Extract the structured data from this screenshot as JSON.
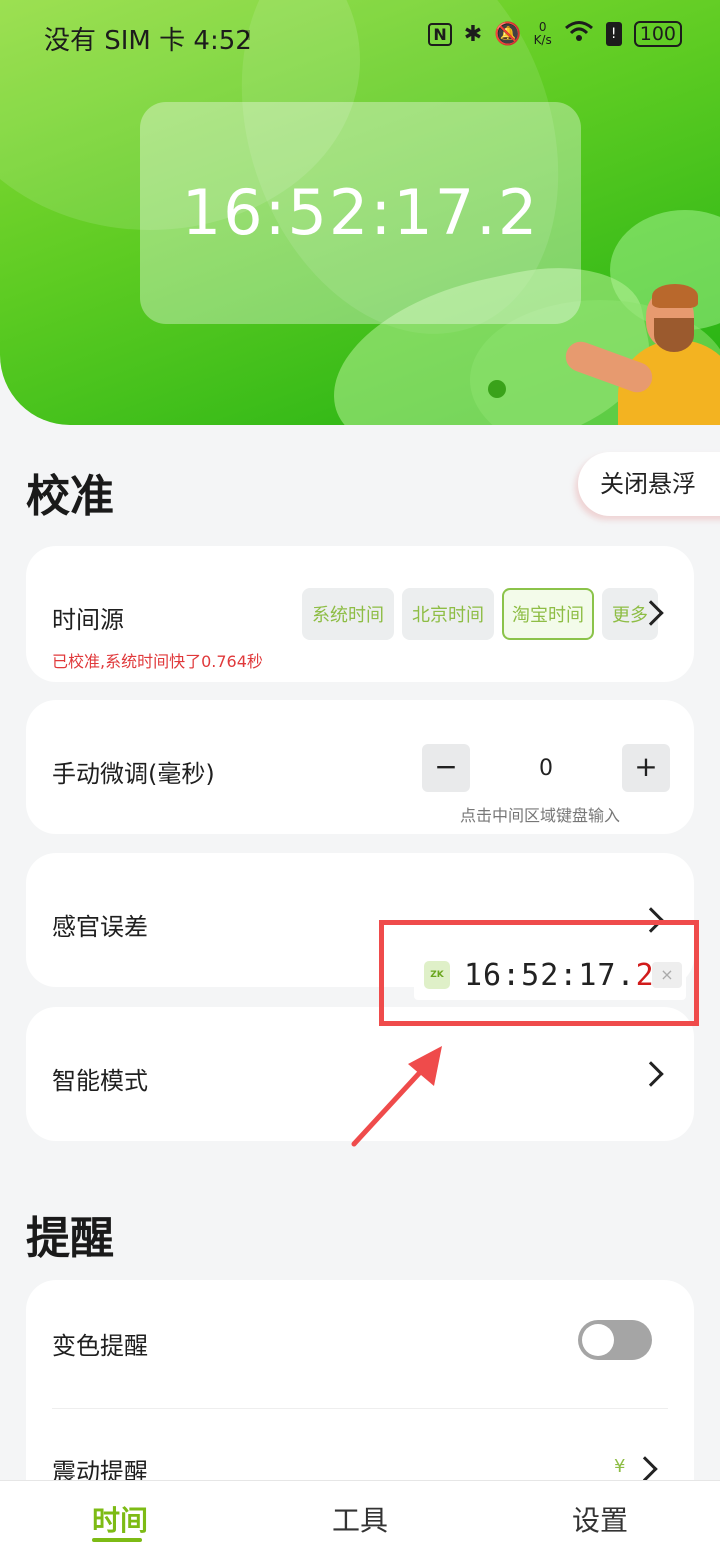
{
  "status_bar": {
    "carrier": "没有 SIM 卡 4:52",
    "nfc": "N",
    "speed_value": "0",
    "speed_unit": "K/s",
    "battery": "100"
  },
  "header": {
    "clock": "16:52:17.2"
  },
  "calibration": {
    "title": "校准",
    "float_button": "关闭悬浮",
    "time_source": {
      "label": "时间源",
      "tabs": [
        "系统时间",
        "北京时间",
        "淘宝时间",
        "更多"
      ],
      "active_tab": "淘宝时间",
      "note": "已校准,系统时间快了0.764秒"
    },
    "manual_adjust": {
      "label": "手动微调(毫秒)",
      "minus": "−",
      "value": "0",
      "plus": "+",
      "hint": "点击中间区域键盘输入"
    },
    "sensory_error": {
      "label": "感官误差"
    },
    "smart_mode": {
      "label": "智能模式"
    }
  },
  "reminders": {
    "title": "提醒",
    "color_reminder": {
      "label": "变色提醒",
      "enabled": false
    },
    "vibration_reminder": {
      "label": "震动提醒",
      "badge": "¥"
    }
  },
  "floating_widget": {
    "icon_text": "ZK",
    "time_main": "16:52:17.",
    "time_tenth": "2",
    "close": "×"
  },
  "bottom_nav": {
    "items": [
      "时间",
      "工具",
      "设置"
    ],
    "active": "时间"
  },
  "colors": {
    "accent": "#7dbb15",
    "warning_text": "#e0393b",
    "highlight_frame": "#ef4b4b"
  }
}
